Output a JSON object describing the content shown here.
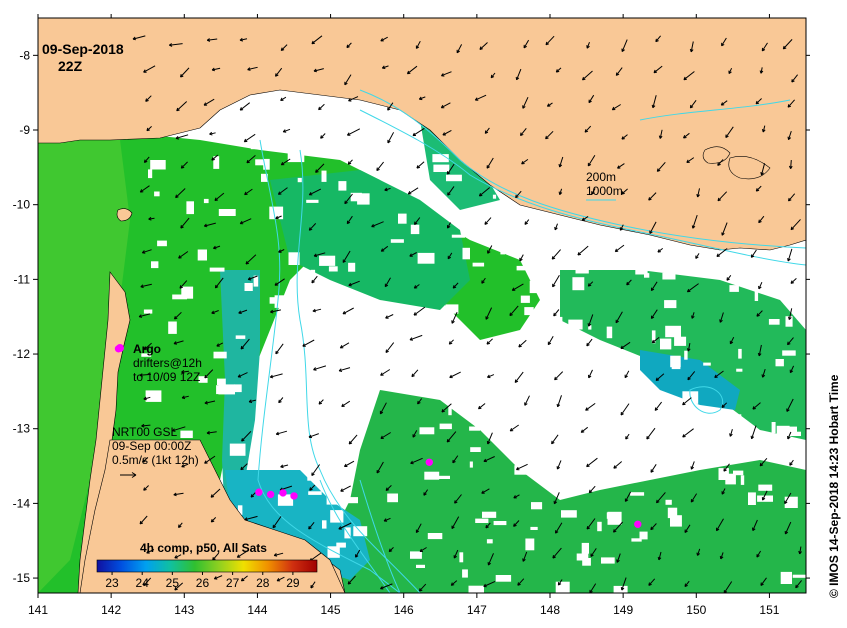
{
  "map": {
    "date_label": "09-Sep-2018",
    "time_label": "22Z",
    "credit": "© IMOS 14-Sep-2018 14:23 Hobart Time",
    "argo_label": "Argo",
    "drifters_label": "drifters@12h",
    "drifters_to_label": "to 10/09 12Z",
    "current_model_label": "NRT00 GSL",
    "current_date_label": "09-Sep 00:00Z",
    "current_scale_label": "0.5m/s (1kt 12h)",
    "bathy_200_label": "200m",
    "bathy_1000_label": "1000m",
    "composite_label": "4h comp, p50, All Sats",
    "colors": {
      "land": "#f9c896",
      "bathymetry": "#40d8e8",
      "argo_marker": "#ff00ff",
      "background": "#ffffff"
    },
    "colorbar": {
      "ticks": [
        "23",
        "24",
        "25",
        "26",
        "27",
        "28",
        "29"
      ],
      "min": 22.5,
      "max": 29.8,
      "stops": [
        "#1010a0",
        "#0050e0",
        "#00a0f0",
        "#10c0a0",
        "#30c030",
        "#90d020",
        "#f0e000",
        "#f09000",
        "#d03010",
        "#a00000"
      ]
    }
  },
  "chart_data": {
    "type": "map",
    "x_axis": {
      "ticks": [
        "141",
        "142",
        "143",
        "144",
        "145",
        "146",
        "147",
        "148",
        "149",
        "150",
        "151"
      ],
      "range": [
        141.0,
        151.5
      ]
    },
    "y_axis": {
      "ticks": [
        "-8",
        "-9",
        "-10",
        "-11",
        "-12",
        "-13",
        "-14",
        "-15"
      ],
      "range": [
        -15.2,
        -7.5
      ]
    },
    "argo_floats": [
      {
        "lon": 142.1,
        "lat": -11.93
      },
      {
        "lon": 146.35,
        "lat": -13.45
      },
      {
        "lon": 149.2,
        "lat": -14.28
      },
      {
        "lon": 144.02,
        "lat": -13.85
      },
      {
        "lon": 144.18,
        "lat": -13.88
      },
      {
        "lon": 144.35,
        "lat": -13.86
      },
      {
        "lon": 144.5,
        "lat": -13.9
      }
    ]
  }
}
